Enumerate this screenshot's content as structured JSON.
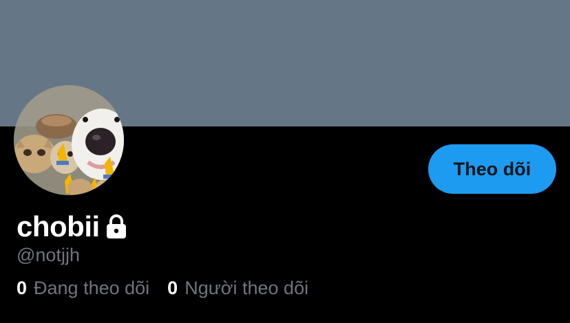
{
  "theme": {
    "banner_color": "#657786",
    "background": "#000000",
    "accent": "#1d9bf0",
    "secondary_text": "#6e767d"
  },
  "profile": {
    "display_name": "chobii",
    "handle": "@notjjh",
    "protected_icon": "lock-icon",
    "avatar": "avatar-image"
  },
  "actions": {
    "follow_label": "Theo dõi"
  },
  "stats": {
    "following_count": "0",
    "following_label": "Đang theo dõi",
    "followers_count": "0",
    "followers_label": "Người theo dõi"
  }
}
